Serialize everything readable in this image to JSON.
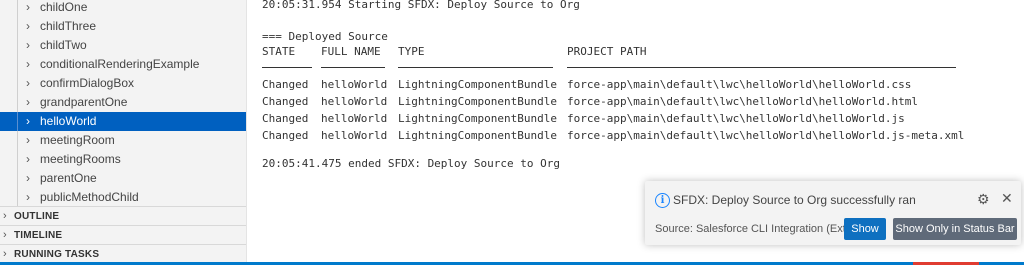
{
  "sidebar": {
    "items": [
      {
        "label": "childOne"
      },
      {
        "label": "childThree"
      },
      {
        "label": "childTwo"
      },
      {
        "label": "conditionalRenderingExample"
      },
      {
        "label": "confirmDialogBox"
      },
      {
        "label": "grandparentOne"
      },
      {
        "label": "helloWorld",
        "selected": true
      },
      {
        "label": "meetingRoom"
      },
      {
        "label": "meetingRooms"
      },
      {
        "label": "parentOne"
      },
      {
        "label": "publicMethodChild"
      }
    ],
    "sections": [
      {
        "label": "OUTLINE"
      },
      {
        "label": "TIMELINE"
      },
      {
        "label": "RUNNING TASKS"
      }
    ]
  },
  "output": {
    "start_line": "20:05:31.954 Starting SFDX: Deploy Source to Org",
    "heading": "=== Deployed Source",
    "columns": [
      "STATE",
      "FULL NAME",
      "TYPE",
      "PROJECT PATH"
    ],
    "rows": [
      [
        "Changed",
        "helloWorld",
        "LightningComponentBundle",
        "force-app\\main\\default\\lwc\\helloWorld\\helloWorld.css"
      ],
      [
        "Changed",
        "helloWorld",
        "LightningComponentBundle",
        "force-app\\main\\default\\lwc\\helloWorld\\helloWorld.html"
      ],
      [
        "Changed",
        "helloWorld",
        "LightningComponentBundle",
        "force-app\\main\\default\\lwc\\helloWorld\\helloWorld.js"
      ],
      [
        "Changed",
        "helloWorld",
        "LightningComponentBundle",
        "force-app\\main\\default\\lwc\\helloWorld\\helloWorld.js-meta.xml"
      ]
    ],
    "end_line": "20:05:41.475 ended SFDX: Deploy Source to Org"
  },
  "notification": {
    "message": "SFDX: Deploy Source to Org successfully ran",
    "source": "Source: Salesforce CLI Integration (Exte...",
    "primary_button": "Show",
    "secondary_button": "Show Only in Status Bar",
    "icons": {
      "info": "info-icon",
      "gear": "gear-icon",
      "close": "close-icon"
    }
  },
  "colors": {
    "selection": "#0060c0",
    "status_bar": "#007acc",
    "primary_button": "#0e70c0",
    "secondary_button": "#5f6a79"
  }
}
